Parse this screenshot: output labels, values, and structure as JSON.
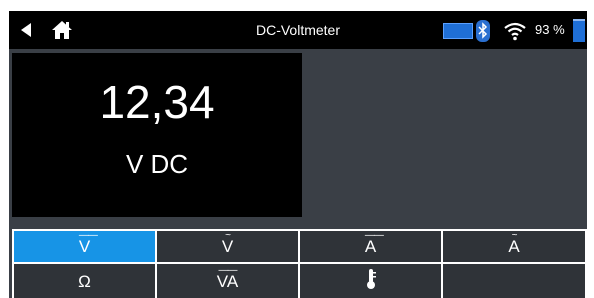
{
  "statusbar": {
    "title": "DC-Voltmeter",
    "battery_percent": "93 %",
    "battery_level": 0.93,
    "icons": [
      "back-arrow-icon",
      "home-icon",
      "usb-connection-icon",
      "bluetooth-icon",
      "wifi-icon",
      "battery-icon"
    ]
  },
  "reading": {
    "value": "12,34",
    "unit": "V DC"
  },
  "modes": [
    {
      "label": "V",
      "overline": "――",
      "active": true
    },
    {
      "label": "V",
      "overline": "~",
      "active": false
    },
    {
      "label": "A",
      "overline": "――",
      "active": false
    },
    {
      "label": "A",
      "overline": "~",
      "active": false
    },
    {
      "label": "Ω",
      "overline": "",
      "active": false
    },
    {
      "label": "VA",
      "overline": "――",
      "active": false
    },
    {
      "label": "",
      "overline": "",
      "active": false,
      "icon": "temperature-probe-icon"
    },
    {
      "label": "",
      "overline": "",
      "active": false
    }
  ],
  "colors": {
    "active_button": "#1794e6",
    "panel_background": "#3a3f46",
    "button_background": "#2f3338"
  }
}
